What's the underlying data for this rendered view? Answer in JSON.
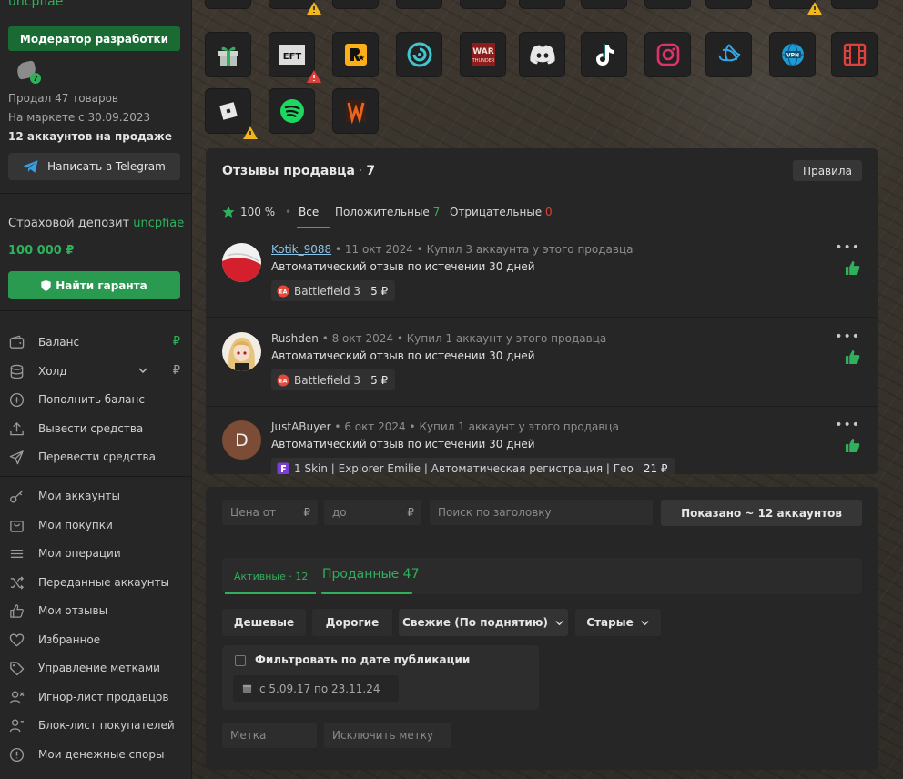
{
  "seller": {
    "username": "uncpfiae",
    "role": "Модератор разработки",
    "achievement_count": "7",
    "sold": "Продал 47 товаров",
    "since": "На маркете с 30.09.2023",
    "on_sale": "12 аккаунтов на продаже",
    "telegram_label": "Написать в Telegram",
    "deposit_title": "Страховой депозит",
    "deposit_user": "uncpfiae",
    "deposit_amount": "100 000 ₽",
    "guarant_label": "Найти гаранта"
  },
  "menu": {
    "balance": "Баланс",
    "hold": "Холд",
    "topup": "Пополнить баланс",
    "withdraw": "Вывести средства",
    "transfer": "Перевести средства",
    "my_accounts": "Мои аккаунты",
    "my_purchases": "Мои покупки",
    "my_operations": "Мои операции",
    "transferred": "Переданные аккаунты",
    "my_reviews": "Мои отзывы",
    "favorites": "Избранное",
    "tags": "Управление метками",
    "ignore_sellers": "Игнор-лист продавцов",
    "block_buyers": "Блок-лист покупателей",
    "disputes": "Мои денежные споры",
    "currency": "₽"
  },
  "icons": [
    "gift-icon",
    "eft-icon",
    "rockstar-icon",
    "ubisoft-icon",
    "warthunder-icon",
    "discord-icon",
    "tiktok-icon",
    "instagram-icon",
    "battlenet-icon",
    "vpn-icon",
    "film-icon",
    "roblox-icon",
    "spotify-icon",
    "wot-icon"
  ],
  "icon_labels": {
    "eft": "EFT",
    "warthunder_1": "WAR",
    "warthunder_2": "THUNDER",
    "vpn": "VPN"
  },
  "reviews": {
    "title": "Отзывы продавца",
    "count": "7",
    "rules": "Правила",
    "rating": "100 %",
    "tab_all": "Все",
    "tab_positive": "Положительные",
    "positive_count": "7",
    "tab_negative": "Отрицательные",
    "negative_count": "0",
    "items": [
      {
        "name": "Kotik_9088",
        "date": "11 окт 2024",
        "bought": "Купил 3 аккаунта у этого продавца",
        "text": "Автоматический отзыв по истечении 30 дней",
        "item": "Battlefield 3",
        "price": "5 ₽",
        "chip_icon": "EA"
      },
      {
        "name": "Rushden",
        "date": "8 окт 2024",
        "bought": "Купил 1 аккаунт у этого продавца",
        "text": "Автоматический отзыв по истечении 30 дней",
        "item": "Battlefield 3",
        "price": "5 ₽",
        "chip_icon": "EA"
      },
      {
        "name": "JustABuyer",
        "avatar_letter": "D",
        "date": "6 окт 2024",
        "bought": "Купил 1 аккаунт у этого продавца",
        "text": "Автоматический отзыв по истечении 30 дней",
        "item": "1 Skin | Explorer Emilie | Автоматическая регистрация | Гео",
        "price": "21 ₽"
      }
    ]
  },
  "accounts": {
    "price_from": "Цена от",
    "price_to": "до",
    "currency": "₽",
    "search_placeholder": "Поиск по заголовку",
    "shown": "Показано ~ 12 аккаунтов",
    "tab_active": "Активные · 12",
    "tab_sold": "Проданные 47",
    "sort_cheap": "Дешевые",
    "sort_expensive": "Дорогие",
    "sort_fresh": "Свежие (По поднятию)",
    "sort_old": "Старые",
    "date_filter_label": "Фильтровать по дате публикации",
    "date_range": "с 5.09.17 по 23.11.24",
    "tag_placeholder": "Метка",
    "exclude_tag_placeholder": "Исключить метку"
  }
}
